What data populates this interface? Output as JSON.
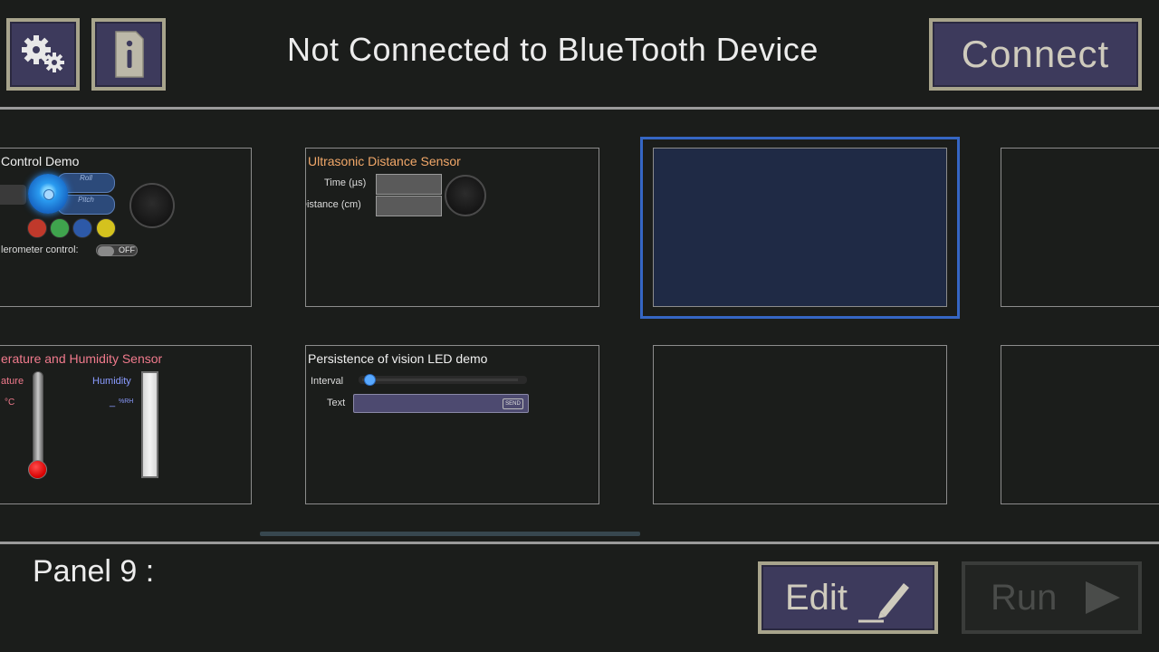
{
  "header": {
    "status_text": "Not Connected to BlueTooth Device",
    "connect_label": "Connect",
    "settings_icon": "gear-icon",
    "info_icon": "info-icon"
  },
  "panels": {
    "control_demo": {
      "title": "Control Demo",
      "roll_label": "Roll",
      "pitch_label": "Pitch",
      "accel_label": "lerometer control:",
      "toggle_label": "OFF",
      "led_colors": [
        "#c0392b",
        "#3fa34d",
        "#2d59a8",
        "#d4c21e"
      ]
    },
    "ultrasonic": {
      "title": "Ultrasonic Distance Sensor",
      "time_label": "Time (µs)",
      "distance_label": "Distance (cm)"
    },
    "temp_humidity": {
      "title": "erature and Humidity Sensor",
      "temp_label": "ature",
      "temp_unit": "°C",
      "humidity_label": "Humidity",
      "humidity_value": "_",
      "humidity_unit": "%RH"
    },
    "pov": {
      "title": "Persistence of vision LED demo",
      "interval_label": "Interval",
      "text_label": "Text",
      "send_label": "SEND"
    }
  },
  "footer": {
    "panel_label": "Panel 9 :",
    "edit_label": "Edit",
    "run_label": "Run"
  },
  "colors": {
    "accent_blue": "#3566c4",
    "button_purple": "#3d3a5c",
    "ultrasonic_title": "#f2a869",
    "temp_title": "#f07a8c",
    "humidity_label": "#8a9bff"
  }
}
